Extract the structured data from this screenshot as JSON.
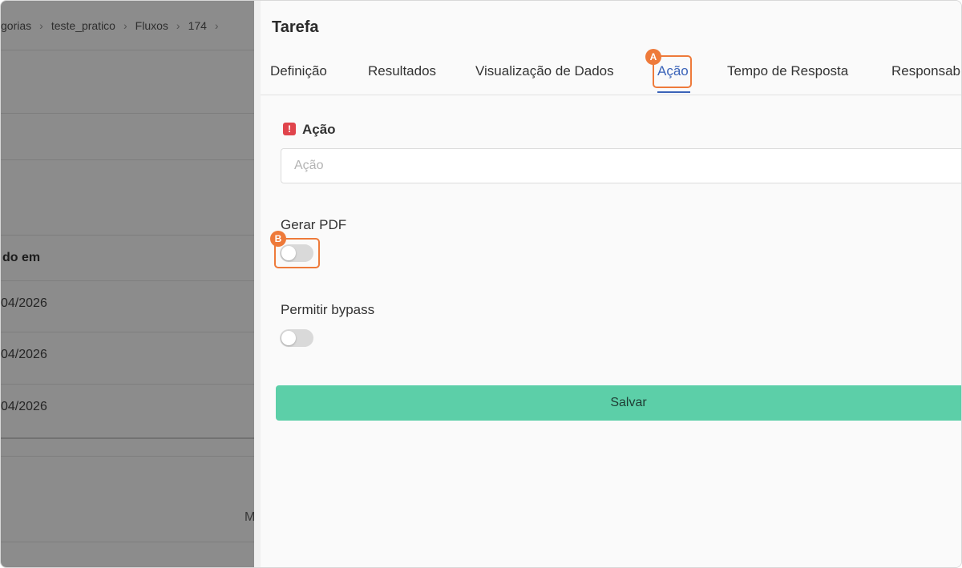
{
  "background_page": {
    "breadcrumb": [
      "gorias",
      "teste_pratico",
      "Fluxos",
      "174"
    ],
    "column_header": "do em",
    "rows": [
      "04/2026",
      "04/2026",
      "04/2026"
    ],
    "partial_text": "M"
  },
  "drawer": {
    "title": "Tarefa",
    "tabs": [
      {
        "label": "Definição"
      },
      {
        "label": "Resultados"
      },
      {
        "label": "Visualização de Dados"
      },
      {
        "label": "Ação"
      },
      {
        "label": "Tempo de Resposta"
      },
      {
        "label": "Responsab"
      }
    ],
    "active_tab": "Ação",
    "action_field": {
      "label": "Ação",
      "required_icon": "!",
      "placeholder": "Ação",
      "value": ""
    },
    "generate_pdf": {
      "label": "Gerar PDF",
      "enabled": false
    },
    "allow_bypass": {
      "label": "Permitir bypass",
      "enabled": false
    },
    "save_label": "Salvar"
  },
  "annotations": {
    "a": "A",
    "b": "B"
  },
  "colors": {
    "accent": "#3a63b8",
    "annotation": "#ee7a3a",
    "save_button": "#5ccfa8",
    "required": "#e0444c"
  }
}
